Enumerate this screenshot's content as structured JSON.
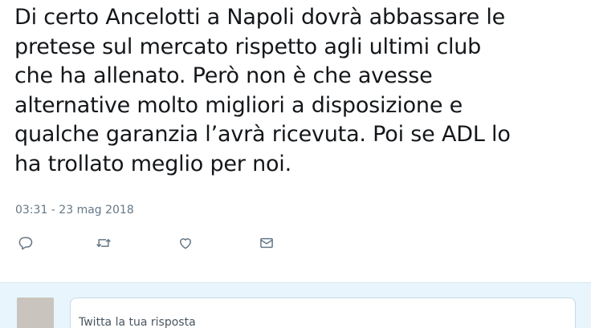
{
  "tweet": {
    "text": "Di certo Ancelotti a Napoli dovrà abbassare le\npretese sul mercato rispetto agli ultimi club\nche ha allenato. Però non è che avesse\nalternative molto migliori a disposizione e\nqualche garanzia l’avrà ricevuta. Poi se ADL lo\nha trollato meglio per noi.",
    "timestamp": "03:31 - 23 mag 2018"
  },
  "actions": {
    "reply_icon": "speech-bubble-icon",
    "retweet_icon": "retweet-arrows-icon",
    "like_icon": "heart-icon",
    "dm_icon": "envelope-icon",
    "icon_color": "#657786"
  },
  "reply": {
    "placeholder": "Twitta la tua risposta",
    "bar_color": "#e8f5fd"
  }
}
